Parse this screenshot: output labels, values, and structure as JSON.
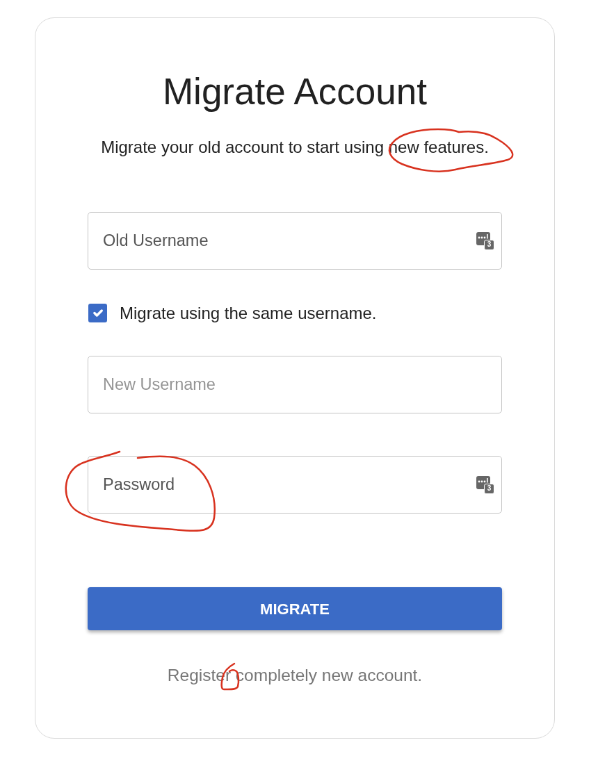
{
  "title": "Migrate Account",
  "subtitle": "Migrate your old account to start using new features.",
  "form_items": [
    {
      "kind": "field",
      "placeholder": "Old Username",
      "disabled": false,
      "autofill_badge": "3"
    },
    {
      "kind": "checkbox",
      "label": "Migrate using the same username.",
      "checked": true
    },
    {
      "kind": "field",
      "placeholder": "New Username",
      "disabled": true
    },
    {
      "kind": "field",
      "placeholder": "Password",
      "disabled": false,
      "autofill_badge": "3"
    }
  ],
  "button": {
    "label": "MIGRATE"
  },
  "link": {
    "label": "Register completely new account."
  }
}
